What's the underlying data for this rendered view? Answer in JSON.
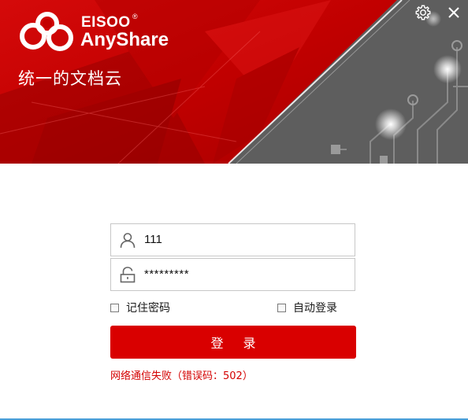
{
  "banner": {
    "brand_top": "EISOO",
    "brand_reg": "®",
    "brand_main": "AnyShare",
    "tagline": "统一的文档云",
    "colors": {
      "primary_red": "#d90000",
      "circuit_gray": "#5a5a5a"
    }
  },
  "titlebar": {
    "settings_icon": "gear-icon",
    "close_icon": "close-icon"
  },
  "login": {
    "username": {
      "value": "111",
      "icon": "user-icon"
    },
    "password": {
      "value": "*********",
      "icon": "lock-icon"
    },
    "remember_label": "记住密码",
    "autologin_label": "自动登录",
    "remember_checked": false,
    "autologin_checked": false,
    "submit_label": "登 录",
    "error": "网络通信失败（错误码：502）"
  }
}
